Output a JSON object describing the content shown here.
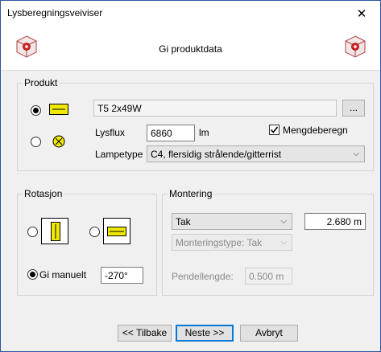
{
  "window": {
    "title": "Lysberegningsveiviser",
    "close_glyph": "✕"
  },
  "header": {
    "title": "Gi produktdata",
    "logo_icon": "product-cube-icon"
  },
  "product": {
    "group_label": "Produkt",
    "option1_icon": "fluorescent-tube-icon",
    "option2_icon": "lamp-bulb-icon",
    "name_value": "T5 2x49W",
    "browse_label": "...",
    "lysflux_label": "Lysflux",
    "lysflux_value": "6860",
    "lysflux_unit": "lm",
    "mengdeberegn_label": "Mengdeberegn",
    "mengdeberegn_checked": true,
    "lampetype_label": "Lampetype",
    "lampetype_value": "C4, flersidig strålende/gitterrist"
  },
  "rotation": {
    "group_label": "Rotasjon",
    "option1_icon": "luminaire-vertical-icon",
    "option2_icon": "luminaire-horizontal-icon",
    "manual_label": "Gi manuelt",
    "manual_value": "-270°"
  },
  "mounting": {
    "group_label": "Montering",
    "type_value": "Tak",
    "height_value": "2.680 m",
    "mounting_type_value": "Monteringstype: Tak",
    "pendel_label": "Pendellengde:",
    "pendel_value": "0.500 m"
  },
  "buttons": {
    "back_label": "<< Tilbake",
    "next_label": "Neste >>",
    "cancel_label": "Avbryt"
  },
  "colors": {
    "accent": "#0078d7",
    "lamp_yellow": "#f0e800"
  }
}
